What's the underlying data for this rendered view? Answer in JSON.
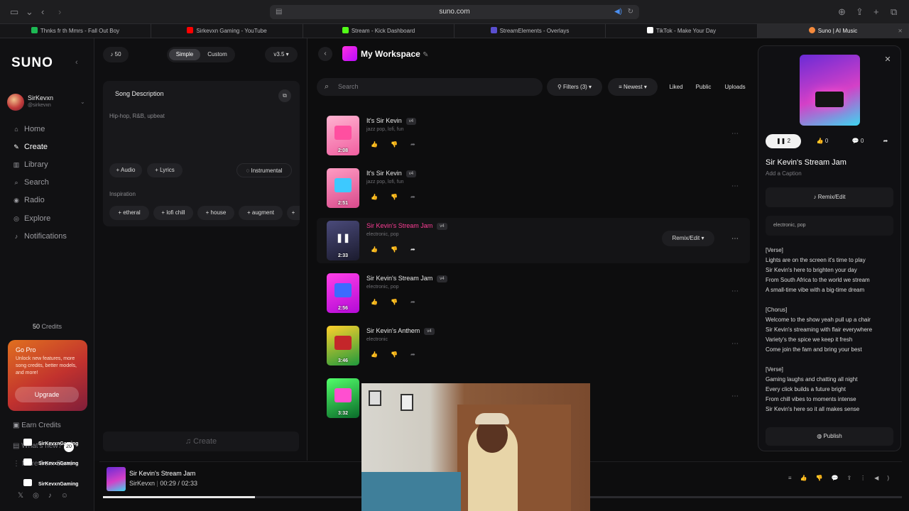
{
  "browser": {
    "url": "suno.com",
    "tabs": [
      {
        "label": "Thnks fr th Mmrs - Fall Out Boy",
        "color": "#1db954"
      },
      {
        "label": "Sirkevxn Gaming - YouTube",
        "color": "#ff0000"
      },
      {
        "label": "Stream - Kick Dashboard",
        "color": "#53fc18"
      },
      {
        "label": "StreamElements - Overlays",
        "color": "#5a4fcf"
      },
      {
        "label": "TikTok - Make Your Day",
        "color": "#ffffff"
      },
      {
        "label": "Suno | AI Music",
        "color": "#f58a3c"
      }
    ]
  },
  "sidebar": {
    "logo": "SUNO",
    "user": {
      "name": "SirKevxn",
      "handle": "@sirkevxn"
    },
    "nav": [
      "Home",
      "Create",
      "Library",
      "Search",
      "Radio",
      "Explore",
      "Notifications"
    ],
    "credits_num": "50",
    "credits_label": "Credits",
    "gopro": {
      "title": "Go Pro",
      "desc": "Unlock new features, more song credits, better models, and more!",
      "button": "Upgrade"
    },
    "earn": "Earn Credits",
    "whatsnew": "What's new?",
    "whatsnew_count": "20",
    "more": "More from Suno"
  },
  "create": {
    "credit_count": "50",
    "mode_simple": "Simple",
    "mode_custom": "Custom",
    "version": "v3.5",
    "song_description_label": "Song Description",
    "song_description_value": "Hip-hop, R&B, upbeat",
    "audio_label": "Audio",
    "lyrics_label": "Lyrics",
    "instrumental_label": "Instrumental",
    "inspiration_label": "Inspiration",
    "inspiration": [
      "etheral",
      "lofi chill",
      "house",
      "augment"
    ],
    "create_button": "Create"
  },
  "workspace": {
    "title": "My Workspace",
    "search_placeholder": "Search",
    "filters": "Filters (3)",
    "sort": "Newest",
    "liked": "Liked",
    "public": "Public",
    "uploads": "Uploads",
    "remix_label": "Remix/Edit",
    "songs": [
      {
        "title": "It's Sir Kevin",
        "version": "v4",
        "tags": "jazz pop, lofi, fun",
        "duration": "2:08",
        "g1": "#ffb3d1",
        "g2": "#f05fa0",
        "glyph": "#ff4fa0"
      },
      {
        "title": "It's Sir Kevin",
        "version": "v4",
        "tags": "jazz pop, lofi, fun",
        "duration": "2:51",
        "g1": "#ff9cc3",
        "g2": "#d84a8c",
        "glyph": "#3dc9ff"
      },
      {
        "title": "Sir Kevin's Stream Jam",
        "version": "v4",
        "tags": "electronic, pop",
        "duration": "2:33",
        "g1": "#4a4a7a",
        "g2": "#1b1b2e",
        "glyph": "#ffffff"
      },
      {
        "title": "Sir Kevin's Stream Jam",
        "version": "v4",
        "tags": "electronic, pop",
        "duration": "2:56",
        "g1": "#ff40e6",
        "g2": "#b40ad8",
        "glyph": "#3c6bff"
      },
      {
        "title": "Sir Kevin's Anthem",
        "version": "v4",
        "tags": "electronic",
        "duration": "3:46",
        "g1": "#ffd02b",
        "g2": "#1f9a3c",
        "glyph": "#c4262a"
      },
      {
        "title": "",
        "version": "",
        "tags": "",
        "duration": "3:32",
        "g1": "#52ff6a",
        "g2": "#0a6b2a",
        "glyph": "#ff4fd0"
      }
    ]
  },
  "detail": {
    "title": "Sir Kevin's Stream Jam",
    "caption_placeholder": "Add a Caption",
    "plays": "2",
    "likes": "0",
    "comments": "0",
    "remix": "Remix/Edit",
    "tags": "electronic, pop",
    "lyrics": [
      "[Verse]",
      "Lights are on the screen it's time to play",
      "Sir Kevin's here to brighten your day",
      "From South Africa to the world we stream",
      "A small-time vibe with a big-time dream",
      "",
      "[Chorus]",
      "Welcome to the show yeah pull up a chair",
      "Sir Kevin's streaming with flair everywhere",
      "Variety's the spice we keep it fresh",
      "Come join the fam and bring your best",
      "",
      "[Verse]",
      "Gaming laughs and chatting all night",
      "Every click builds a future bright",
      "From chill vibes to moments intense",
      "Sir Kevin's here so it all makes sense"
    ],
    "publish": "Publish"
  },
  "player": {
    "title": "Sir Kevin's Stream Jam",
    "artist": "SirKevxn",
    "separator": "|",
    "current": "00:29",
    "total": "02:33",
    "progress_fraction": 0.19
  },
  "overlay": {
    "social_handles": [
      "SirKevxnGaming",
      "SirKevxnGaming",
      "SirKevxnGaming"
    ]
  }
}
